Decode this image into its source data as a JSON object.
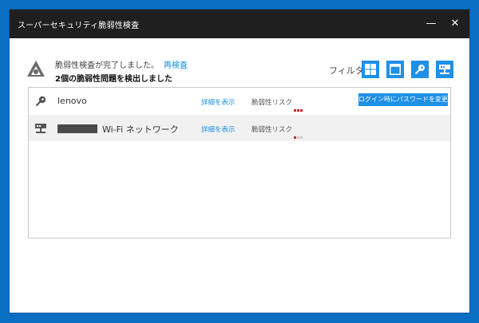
{
  "window": {
    "title": "スーパーセキュリティ脆弱性検査"
  },
  "status": {
    "line1": "脆弱性検査が完了しました。",
    "rescan_label": "再検査",
    "line2": "2個の脆弱性問題を検出しました"
  },
  "filter": {
    "label": "フィルタ",
    "buttons": [
      "windows-icon",
      "window-app-icon",
      "key-icon",
      "network-icon"
    ]
  },
  "issues": [
    {
      "name": "lenovo",
      "icon": "key-icon",
      "detail_label": "詳細を表示",
      "risk_label": "脆弱性リスク",
      "risk_level": 3,
      "action_label": "ログイン時にパスワードを変更"
    },
    {
      "name": "Wi-Fi ネットワーク",
      "icon": "network-icon",
      "detail_label": "詳細を表示",
      "risk_label": "脆弱性リスク",
      "risk_level": 1
    }
  ],
  "colors": {
    "accent": "#1e90e6",
    "titlebar": "#1f1f1f",
    "risk_active": "#e02020",
    "risk_inactive": "#c8c8c8",
    "background": "#0a6fc2"
  }
}
